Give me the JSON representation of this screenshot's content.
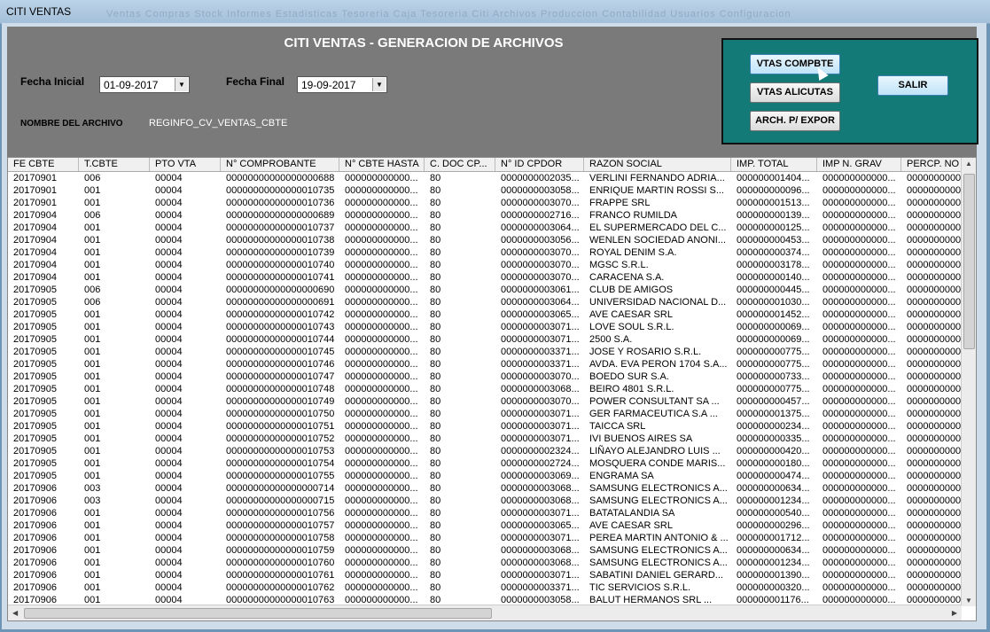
{
  "window": {
    "title": "CITI VENTAS",
    "ghost_menu": "Ventas Compras  Stock  Informes  Estadisticas  Tesoreria  Caja Tesoreria  Citi Archivos  Produccion  Contabilidad  Usuarios  Configuracion"
  },
  "header": {
    "title": "CITI VENTAS - GENERACION DE ARCHIVOS"
  },
  "filters": {
    "fecha_inicial_label": "Fecha Inicial",
    "fecha_inicial": "01-09-2017",
    "fecha_final_label": "Fecha Final",
    "fecha_final": "19-09-2017",
    "nombre_label": "NOMBRE DEL ARCHIVO",
    "nombre_value": "REGINFO_CV_VENTAS_CBTE"
  },
  "buttons": {
    "vtas_compbte": "VTAS COMPBTE",
    "vtas_alicutas": "VTAS ALICUTAS",
    "arch_expor": "ARCH. P/ EXPOR",
    "salir": "SALIR"
  },
  "grid": {
    "columns": [
      "FE CBTE",
      "T.CBTE",
      "PTO VTA",
      "N° COMPROBANTE",
      "N° CBTE HASTA",
      "C. DOC CP...",
      "N° ID CPDOR",
      "RAZON SOCIAL",
      "IMP. TOTAL",
      "IMP N. GRAV",
      "PERCP. NO"
    ],
    "rows": [
      [
        "20170901",
        "006",
        "00004",
        "00000000000000000688",
        "000000000000...",
        "80",
        "0000000002035...",
        "VERLINI FERNANDO ADRIA...",
        "000000001404...",
        "000000000000...",
        "0000000000"
      ],
      [
        "20170901",
        "001",
        "00004",
        "00000000000000010735",
        "000000000000...",
        "80",
        "0000000003058...",
        "ENRIQUE MARTIN ROSSI S...",
        "000000000096...",
        "000000000000...",
        "0000000000"
      ],
      [
        "20170901",
        "001",
        "00004",
        "00000000000000010736",
        "000000000000...",
        "80",
        "0000000003070...",
        "FRAPPE SRL",
        "000000001513...",
        "000000000000...",
        "0000000000"
      ],
      [
        "20170904",
        "006",
        "00004",
        "00000000000000000689",
        "000000000000...",
        "80",
        "0000000002716...",
        "FRANCO RUMILDA",
        "000000000139...",
        "000000000000...",
        "0000000000"
      ],
      [
        "20170904",
        "001",
        "00004",
        "00000000000000010737",
        "000000000000...",
        "80",
        "0000000003064...",
        "EL SUPERMERCADO DEL C...",
        "000000000125...",
        "000000000000...",
        "0000000000"
      ],
      [
        "20170904",
        "001",
        "00004",
        "00000000000000010738",
        "000000000000...",
        "80",
        "0000000003056...",
        "WENLEN SOCIEDAD ANONI...",
        "000000000453...",
        "000000000000...",
        "0000000000"
      ],
      [
        "20170904",
        "001",
        "00004",
        "00000000000000010739",
        "000000000000...",
        "80",
        "0000000003070...",
        "ROYAL DENIM S.A.",
        "000000000374...",
        "000000000000...",
        "0000000000"
      ],
      [
        "20170904",
        "001",
        "00004",
        "00000000000000010740",
        "000000000000...",
        "80",
        "0000000003070...",
        "MGSC S.R.L.",
        "000000003178...",
        "000000000000...",
        "0000000000"
      ],
      [
        "20170904",
        "001",
        "00004",
        "00000000000000010741",
        "000000000000...",
        "80",
        "0000000003070...",
        "CARACENA S.A.",
        "000000000140...",
        "000000000000...",
        "0000000000"
      ],
      [
        "20170905",
        "006",
        "00004",
        "00000000000000000690",
        "000000000000...",
        "80",
        "0000000003061...",
        "CLUB DE AMIGOS",
        "000000000445...",
        "000000000000...",
        "0000000000"
      ],
      [
        "20170905",
        "006",
        "00004",
        "00000000000000000691",
        "000000000000...",
        "80",
        "0000000003064...",
        "UNIVERSIDAD NACIONAL D...",
        "000000001030...",
        "000000000000...",
        "0000000000"
      ],
      [
        "20170905",
        "001",
        "00004",
        "00000000000000010742",
        "000000000000...",
        "80",
        "0000000003065...",
        "AVE CAESAR SRL",
        "000000001452...",
        "000000000000...",
        "0000000000"
      ],
      [
        "20170905",
        "001",
        "00004",
        "00000000000000010743",
        "000000000000...",
        "80",
        "0000000003071...",
        "LOVE SOUL S.R.L.",
        "000000000069...",
        "000000000000...",
        "0000000000"
      ],
      [
        "20170905",
        "001",
        "00004",
        "00000000000000010744",
        "000000000000...",
        "80",
        "0000000003071...",
        "2500 S.A.",
        "000000000069...",
        "000000000000...",
        "0000000000"
      ],
      [
        "20170905",
        "001",
        "00004",
        "00000000000000010745",
        "000000000000...",
        "80",
        "0000000003371...",
        "JOSE Y ROSARIO S.R.L.",
        "000000000775...",
        "000000000000...",
        "0000000000"
      ],
      [
        "20170905",
        "001",
        "00004",
        "00000000000000010746",
        "000000000000...",
        "80",
        "0000000003371...",
        "AVDA. EVA PERON 1704 S.A...",
        "000000000775...",
        "000000000000...",
        "0000000000"
      ],
      [
        "20170905",
        "001",
        "00004",
        "00000000000000010747",
        "000000000000...",
        "80",
        "0000000003070...",
        "BOEDO SUR S.A.",
        "000000000733...",
        "000000000000...",
        "0000000000"
      ],
      [
        "20170905",
        "001",
        "00004",
        "00000000000000010748",
        "000000000000...",
        "80",
        "0000000003068...",
        "BEIRO 4801 S.R.L.",
        "000000000775...",
        "000000000000...",
        "0000000000"
      ],
      [
        "20170905",
        "001",
        "00004",
        "00000000000000010749",
        "000000000000...",
        "80",
        "0000000003070...",
        "POWER CONSULTANT SA ...",
        "000000000457...",
        "000000000000...",
        "0000000000"
      ],
      [
        "20170905",
        "001",
        "00004",
        "00000000000000010750",
        "000000000000...",
        "80",
        "0000000003071...",
        "GER FARMACEUTICA S.A ...",
        "000000001375...",
        "000000000000...",
        "0000000000"
      ],
      [
        "20170905",
        "001",
        "00004",
        "00000000000000010751",
        "000000000000...",
        "80",
        "0000000003071...",
        "TAICCA SRL",
        "000000000234...",
        "000000000000...",
        "0000000000"
      ],
      [
        "20170905",
        "001",
        "00004",
        "00000000000000010752",
        "000000000000...",
        "80",
        "0000000003071...",
        "IVI BUENOS AIRES SA",
        "000000000335...",
        "000000000000...",
        "0000000000"
      ],
      [
        "20170905",
        "001",
        "00004",
        "00000000000000010753",
        "000000000000...",
        "80",
        "0000000002324...",
        "LIÑAYO ALEJANDRO LUIS ...",
        "000000000420...",
        "000000000000...",
        "0000000000"
      ],
      [
        "20170905",
        "001",
        "00004",
        "00000000000000010754",
        "000000000000...",
        "80",
        "0000000002724...",
        "MOSQUERA CONDE MARIS...",
        "000000000180...",
        "000000000000...",
        "0000000000"
      ],
      [
        "20170905",
        "001",
        "00004",
        "00000000000000010755",
        "000000000000...",
        "80",
        "0000000003069...",
        "ENGRAMA SA",
        "000000000474...",
        "000000000000...",
        "0000000000"
      ],
      [
        "20170906",
        "003",
        "00004",
        "00000000000000000714",
        "000000000000...",
        "80",
        "0000000003068...",
        "SAMSUNG ELECTRONICS A...",
        "000000000634...",
        "000000000000...",
        "0000000000"
      ],
      [
        "20170906",
        "003",
        "00004",
        "00000000000000000715",
        "000000000000...",
        "80",
        "0000000003068...",
        "SAMSUNG ELECTRONICS A...",
        "000000001234...",
        "000000000000...",
        "0000000000"
      ],
      [
        "20170906",
        "001",
        "00004",
        "00000000000000010756",
        "000000000000...",
        "80",
        "0000000003071...",
        "BATATALANDIA SA",
        "000000000540...",
        "000000000000...",
        "0000000000"
      ],
      [
        "20170906",
        "001",
        "00004",
        "00000000000000010757",
        "000000000000...",
        "80",
        "0000000003065...",
        "AVE CAESAR SRL",
        "000000000296...",
        "000000000000...",
        "0000000000"
      ],
      [
        "20170906",
        "001",
        "00004",
        "00000000000000010758",
        "000000000000...",
        "80",
        "0000000003071...",
        "PEREA MARTIN ANTONIO & ...",
        "000000001712...",
        "000000000000...",
        "0000000000"
      ],
      [
        "20170906",
        "001",
        "00004",
        "00000000000000010759",
        "000000000000...",
        "80",
        "0000000003068...",
        "SAMSUNG ELECTRONICS A...",
        "000000000634...",
        "000000000000...",
        "0000000000"
      ],
      [
        "20170906",
        "001",
        "00004",
        "00000000000000010760",
        "000000000000...",
        "80",
        "0000000003068...",
        "SAMSUNG ELECTRONICS A...",
        "000000001234...",
        "000000000000...",
        "0000000000"
      ],
      [
        "20170906",
        "001",
        "00004",
        "00000000000000010761",
        "000000000000...",
        "80",
        "0000000003071...",
        "SABATINI DANIEL GERARD...",
        "000000001390...",
        "000000000000...",
        "0000000000"
      ],
      [
        "20170906",
        "001",
        "00004",
        "00000000000000010762",
        "000000000000...",
        "80",
        "0000000003371...",
        "TIC SERVICIOS S.R.L.",
        "000000000320...",
        "000000000000...",
        "0000000000"
      ],
      [
        "20170906",
        "001",
        "00004",
        "00000000000000010763",
        "000000000000...",
        "80",
        "0000000003058...",
        "BALUT HERMANOS SRL ...",
        "000000001176...",
        "000000000000...",
        "0000000000"
      ]
    ]
  },
  "colors": {
    "panel": "#7a7a7a",
    "button_box": "#147a78",
    "window_bg": "#cfdcea"
  }
}
